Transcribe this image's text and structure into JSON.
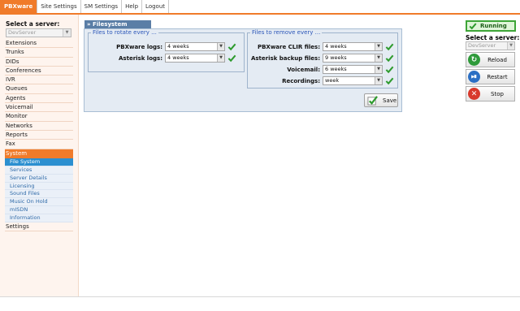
{
  "nav": {
    "tabs": [
      "PBXware",
      "Site Settings",
      "SM Settings",
      "Help",
      "Logout"
    ]
  },
  "sidebar": {
    "server_label": "Select a server:",
    "server_value": "DevServer",
    "items": [
      "Extensions",
      "Trunks",
      "DIDs",
      "Conferences",
      "IVR",
      "Queues",
      "Agents",
      "Voicemail",
      "Monitor",
      "Networks",
      "Reports",
      "Fax",
      "System"
    ],
    "subitems": [
      "File System",
      "Services",
      "Server Details",
      "Licensing",
      "Sound Files",
      "Music On Hold",
      "mISDN",
      "Information"
    ],
    "after_items": [
      "Settings"
    ]
  },
  "panel": {
    "title": "» Filesystem",
    "rotate": {
      "legend": "Files to rotate every ...",
      "rows": [
        {
          "label": "PBXware logs:",
          "value": "4 weeks"
        },
        {
          "label": "Asterisk logs:",
          "value": "4 weeks"
        }
      ]
    },
    "remove": {
      "legend": "Files to remove every ...",
      "rows": [
        {
          "label": "PBXware CLIR files:",
          "value": "4 weeks"
        },
        {
          "label": "Asterisk backup files:",
          "value": "9 weeks"
        },
        {
          "label": "Voicemail:",
          "value": "6 weeks"
        },
        {
          "label": "Recordings:",
          "value": "week"
        }
      ]
    },
    "save_label": "Save"
  },
  "right": {
    "status": "Running",
    "server_label": "Select a server:",
    "server_value": "DevServer",
    "buttons": [
      "Reload",
      "Restart",
      "Stop"
    ]
  },
  "colors": {
    "accent": "#f07b2a",
    "panel_header": "#5a7ea6",
    "status_green": "#3da537"
  }
}
